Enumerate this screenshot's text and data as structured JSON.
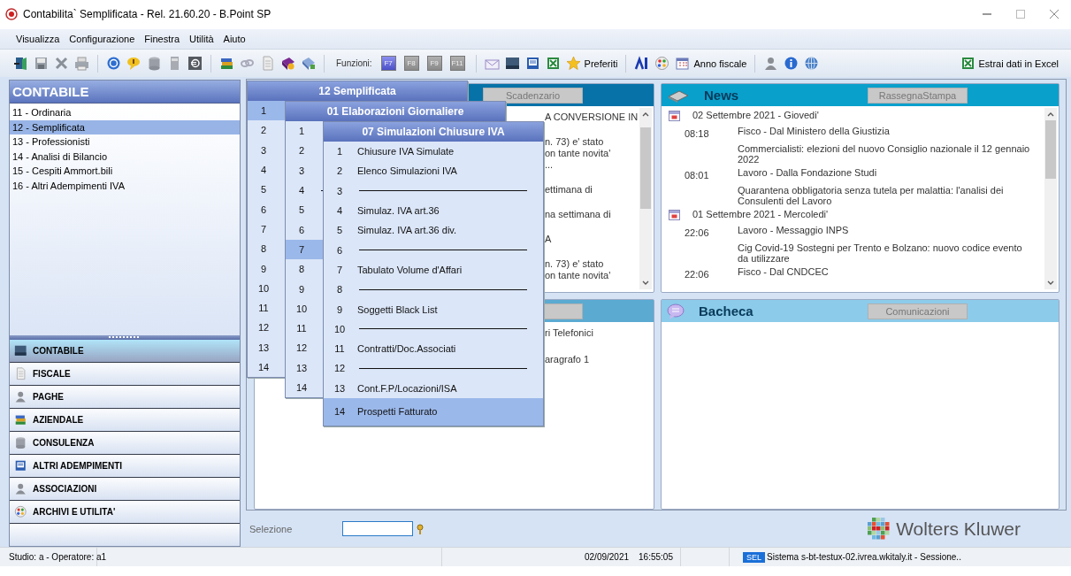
{
  "window": {
    "title": "Contabilita` Semplificata - Rel. 21.60.20 - B.Point SP"
  },
  "menu_bar": [
    "Visualizza",
    "Configurazione",
    "Finestra",
    "Utilità",
    "Aiuto"
  ],
  "toolbar": {
    "functions_label": "Funzioni:",
    "function_keys": [
      {
        "label": "F7",
        "disabled": false
      },
      {
        "label": "F8",
        "disabled": true
      },
      {
        "label": "F9",
        "disabled": true
      },
      {
        "label": "F11",
        "disabled": true
      }
    ],
    "favorites": "Preferiti",
    "fiscal_year": "Anno fiscale",
    "export": "Estrai dati in Excel"
  },
  "sidebar": {
    "title": "CONTABILE",
    "items": [
      {
        "label": "11 - Ordinaria",
        "selected": false
      },
      {
        "label": "12 - Semplificata",
        "selected": true
      },
      {
        "label": "13 - Professionisti",
        "selected": false
      },
      {
        "label": "14 - Analisi di Bilancio",
        "selected": false
      },
      {
        "label": "15 - Cespiti Ammort.bili",
        "selected": false
      },
      {
        "label": "16 - Altri Adempimenti IVA",
        "selected": false
      }
    ],
    "sections": [
      {
        "label": "CONTABILE",
        "selected": true
      },
      {
        "label": "FISCALE",
        "selected": false
      },
      {
        "label": "PAGHE",
        "selected": false
      },
      {
        "label": "AZIENDALE",
        "selected": false
      },
      {
        "label": "CONSULENZA",
        "selected": false
      },
      {
        "label": "ALTRI ADEMPIMENTI",
        "selected": false
      },
      {
        "label": "ASSOCIAZIONI",
        "selected": false
      },
      {
        "label": "ARCHIVI E UTILITA'",
        "selected": false
      }
    ]
  },
  "deadlines_panel": {
    "button": "Scadenzario",
    "excerpts": [
      [
        "A CONVERSIONE IN"
      ],
      [
        "n. 73) e' stato",
        "on tante novita'",
        "..."
      ],
      [
        "ettimana di"
      ],
      [
        "na settimana di"
      ],
      [
        "A"
      ],
      [
        "n. 73) e' stato",
        "on tante novita'"
      ]
    ]
  },
  "news_panel": {
    "title": "News",
    "button": "RassegnaStampa",
    "days": [
      {
        "date": "02 Settembre 2021 - Giovedi'",
        "entries": [
          {
            "time": "08:18",
            "category": "Fisco - Dal Ministero della Giustizia",
            "headline": "Commercialisti: elezioni del nuovo Consiglio nazionale il 12 gennaio 2022"
          },
          {
            "time": "08:01",
            "category": "Lavoro - Dalla Fondazione Studi",
            "headline": "Quarantena obbligatoria senza tutela per malattia: l'analisi dei Consulenti del Lavoro"
          }
        ]
      },
      {
        "date": "01 Settembre 2021 - Mercoledi'",
        "entries": [
          {
            "time": "22:06",
            "category": "Lavoro - Messaggio INPS",
            "headline": "Cig Covid-19 Sostegni per Trento e Bolzano: nuovo codice evento da utilizzare"
          },
          {
            "time": "22:06",
            "category": "Fisco - Dal CNDCEC"
          }
        ]
      }
    ]
  },
  "second_panel": {
    "excerpts": [
      [
        "ri Telefonici"
      ],
      [
        "aragrafo 1"
      ]
    ]
  },
  "board_panel": {
    "title": "Bacheca",
    "button": "Comunicazioni"
  },
  "menus": [
    {
      "title": "12 Semplificata",
      "items": [
        {
          "number": "1",
          "kind": "item",
          "selected": true
        },
        {
          "number": "2",
          "kind": "item",
          "selected": false
        },
        {
          "number": "3",
          "kind": "item",
          "selected": false
        },
        {
          "number": "4",
          "kind": "item",
          "selected": false
        },
        {
          "number": "5",
          "kind": "item",
          "selected": false
        },
        {
          "number": "6",
          "kind": "item",
          "selected": false
        },
        {
          "number": "7",
          "kind": "item",
          "selected": false
        },
        {
          "number": "8",
          "kind": "item",
          "selected": false
        },
        {
          "number": "9",
          "kind": "item",
          "selected": false
        },
        {
          "number": "10",
          "kind": "item",
          "selected": false
        },
        {
          "number": "11",
          "kind": "item",
          "selected": false
        },
        {
          "number": "12",
          "kind": "item",
          "selected": false
        },
        {
          "number": "13",
          "kind": "item",
          "selected": false
        },
        {
          "number": "14",
          "kind": "item",
          "selected": false
        }
      ]
    },
    {
      "title": "01 Elaborazioni Giornaliere",
      "items": [
        {
          "number": "1",
          "kind": "item",
          "selected": false
        },
        {
          "number": "2",
          "kind": "item",
          "selected": false
        },
        {
          "number": "3",
          "kind": "item",
          "selected": false
        },
        {
          "number": "4",
          "kind": "separator",
          "selected": false
        },
        {
          "number": "5",
          "kind": "item",
          "selected": false
        },
        {
          "number": "6",
          "kind": "item",
          "selected": false
        },
        {
          "number": "7",
          "kind": "item",
          "selected": true
        },
        {
          "number": "8",
          "kind": "item",
          "selected": false
        },
        {
          "number": "9",
          "kind": "item",
          "selected": false
        },
        {
          "number": "10",
          "kind": "item",
          "selected": false
        },
        {
          "number": "11",
          "kind": "item",
          "selected": false
        },
        {
          "number": "12",
          "kind": "item",
          "selected": false
        },
        {
          "number": "13",
          "kind": "item",
          "selected": false
        },
        {
          "number": "14",
          "kind": "item",
          "selected": false
        }
      ]
    },
    {
      "title": "07 Simulazioni Chiusure IVA",
      "items": [
        {
          "number": "1",
          "label": "Chiusure IVA Simulate",
          "kind": "item",
          "selected": false
        },
        {
          "number": "2",
          "label": "Elenco Simulazioni IVA",
          "kind": "item",
          "selected": false
        },
        {
          "number": "3",
          "kind": "separator",
          "selected": false
        },
        {
          "number": "4",
          "label": "Simulaz. IVA art.36",
          "kind": "item",
          "selected": false
        },
        {
          "number": "5",
          "label": "Simulaz. IVA art.36 div.",
          "kind": "item",
          "selected": false
        },
        {
          "number": "6",
          "kind": "separator",
          "selected": false
        },
        {
          "number": "7",
          "label": "Tabulato Volume d'Affari",
          "kind": "item",
          "selected": false
        },
        {
          "number": "8",
          "kind": "separator",
          "selected": false
        },
        {
          "number": "9",
          "label": "Soggetti Black List",
          "kind": "item",
          "selected": false
        },
        {
          "number": "10",
          "kind": "separator",
          "selected": false
        },
        {
          "number": "11",
          "label": "Contratti/Doc.Associati",
          "kind": "item",
          "selected": false
        },
        {
          "number": "12",
          "kind": "separator",
          "selected": false
        },
        {
          "number": "13",
          "label": "Cont.F.P/Locazioni/ISA",
          "kind": "item",
          "selected": false
        },
        {
          "number": "14",
          "label": "Prospetti Fatturato",
          "kind": "item",
          "selected": true
        }
      ]
    }
  ],
  "selection": {
    "label": "Selezione"
  },
  "logo": {
    "text": "Wolters Kluwer"
  },
  "status_bar": {
    "user": "Studio: a - Operatore: a1",
    "date": "02/09/2021",
    "time": "16:55:05",
    "badge": "SEL",
    "system": "Sistema s-bt-testux-02.ivrea.wkitaly.it - Sessione.."
  }
}
